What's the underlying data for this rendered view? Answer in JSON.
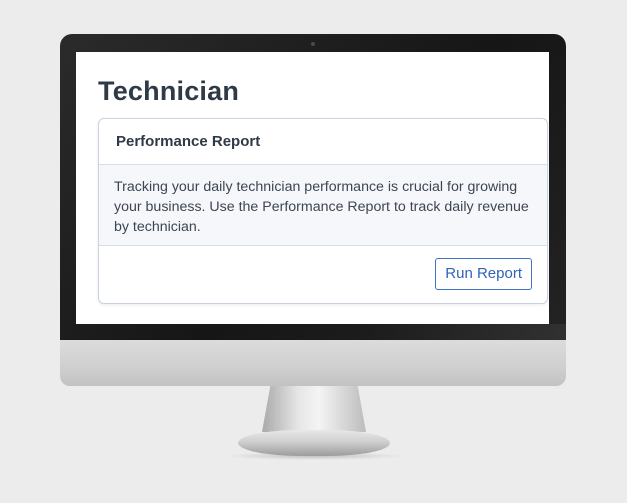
{
  "page": {
    "title": "Technician"
  },
  "card": {
    "header_title": "Performance Report",
    "description": "Tracking your daily technician performance is crucial for growing your business. Use the Performance Report to track daily revenue by technician.",
    "button_label": "Run Report"
  },
  "colors": {
    "title_text": "#2f3a47",
    "button_accent": "#3f73c6",
    "card_body_bg": "#f5f7fa",
    "card_border": "#c9d3df"
  }
}
